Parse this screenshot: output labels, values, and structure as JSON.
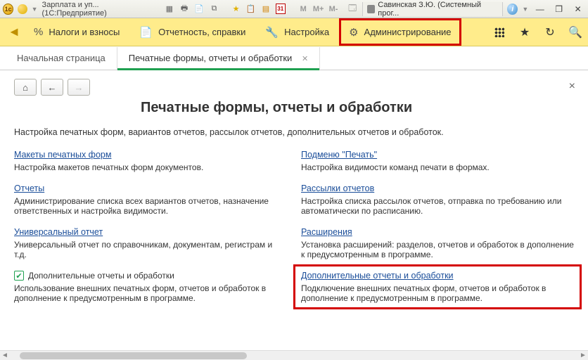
{
  "titlebar": {
    "app_label": "Зарплата и уп... (1С:Предприятие)",
    "user_label": "Савинская З.Ю. (Системный прог...",
    "m_icons": [
      "M",
      "M+",
      "M-"
    ],
    "cal_text": "31"
  },
  "toolbar": {
    "items": [
      {
        "icon": "%",
        "label": "Налоги и взносы"
      },
      {
        "icon": "📄",
        "label": "Отчетность, справки"
      },
      {
        "icon": "🔧",
        "label": "Настройка"
      },
      {
        "icon": "⚙",
        "label": "Администрирование"
      }
    ]
  },
  "tabs": {
    "start": "Начальная страница",
    "current": "Печатные формы, отчеты и обработки"
  },
  "page": {
    "title": "Печатные формы, отчеты и обработки",
    "subtitle": "Настройка печатных форм, вариантов отчетов, рассылок отчетов, дополнительных отчетов и обработок."
  },
  "left": {
    "s1": {
      "link": "Макеты печатных форм",
      "desc": "Настройка макетов печатных форм документов."
    },
    "s2": {
      "link": "Отчеты",
      "desc": "Администрирование списка всех вариантов отчетов, назначение ответственных и настройка видимости."
    },
    "s3": {
      "link": "Универсальный отчет",
      "desc": "Универсальный отчет по справочникам, документам, регистрам и т.д."
    },
    "s4": {
      "chk_label": "Дополнительные отчеты и обработки",
      "desc": "Использование внешних печатных форм, отчетов и обработок в дополнение к предусмотренным в программе."
    }
  },
  "right": {
    "s1": {
      "link": "Подменю \"Печать\"",
      "desc": "Настройка видимости команд печати в формах."
    },
    "s2": {
      "link": "Рассылки отчетов",
      "desc": "Настройка списка рассылок отчетов, отправка по требованию или автоматически по расписанию."
    },
    "s3": {
      "link": "Расширения",
      "desc": "Установка расширений: разделов, отчетов и обработок в дополнение к предусмотренным в программе."
    },
    "s4": {
      "link": "Дополнительные отчеты и обработки",
      "desc": "Подключение внешних печатных форм, отчетов и обработок в дополнение к предусмотренным в программе."
    }
  }
}
